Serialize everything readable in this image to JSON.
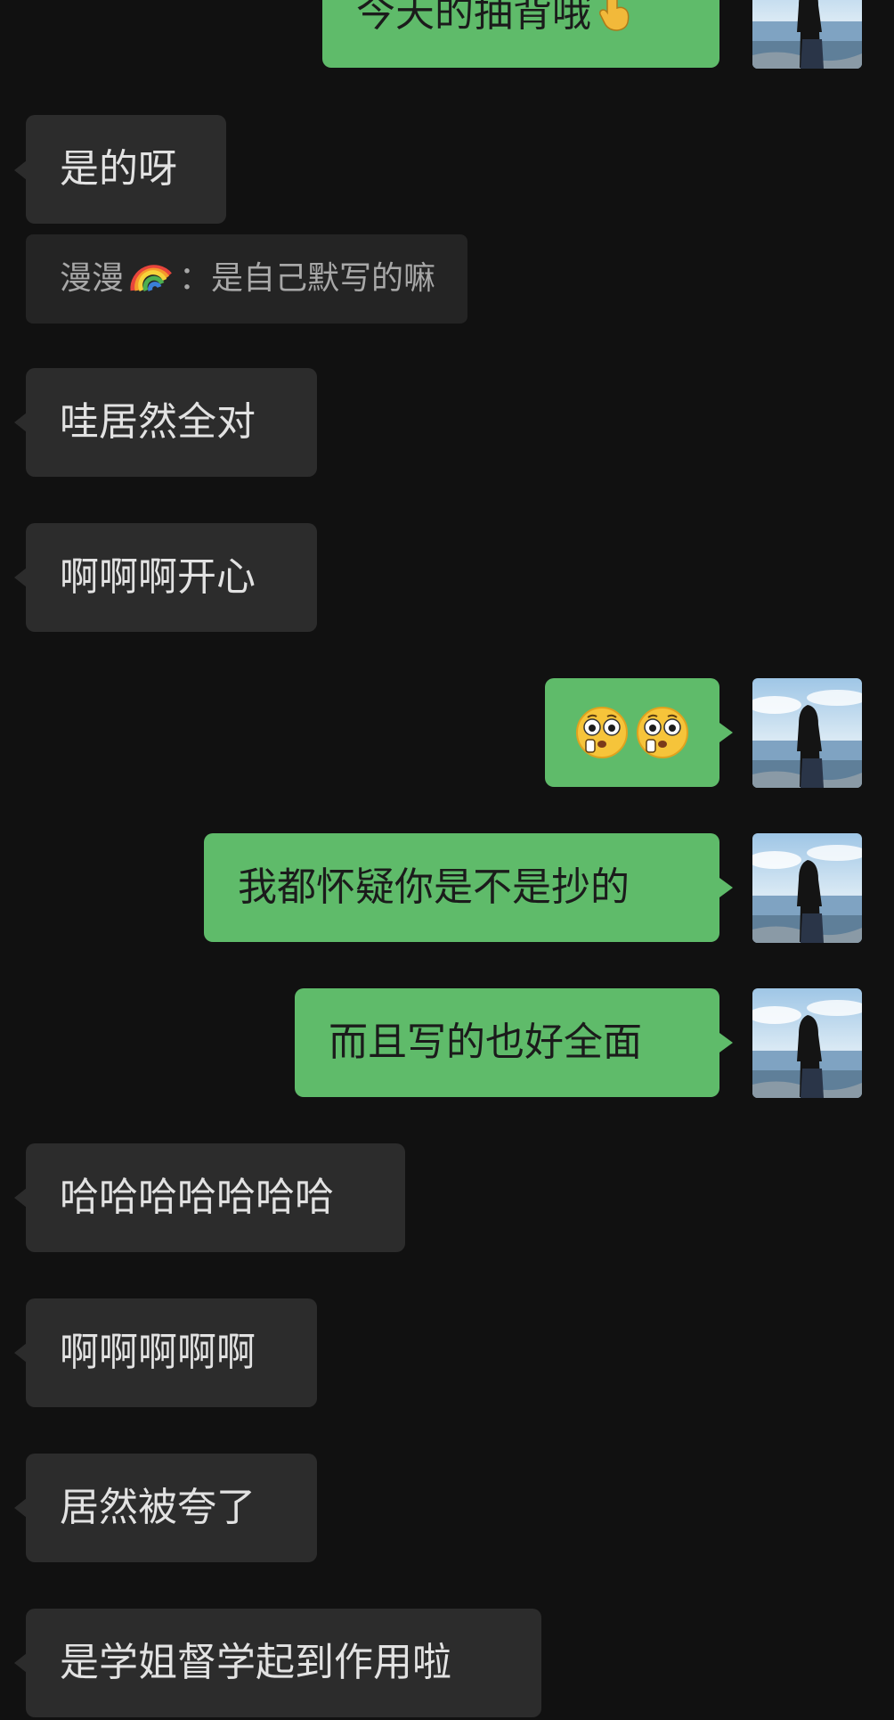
{
  "conversation": {
    "messages": [
      {
        "side": "out",
        "text": "今天的抽背哦",
        "trailing_icon": "pointing-finger-icon"
      },
      {
        "side": "in",
        "text": "是的呀"
      },
      {
        "side": "in",
        "text": "哇居然全对"
      },
      {
        "side": "in",
        "text": "啊啊啊开心"
      },
      {
        "side": "out",
        "emoji": [
          "flushed-face-icon",
          "flushed-face-icon"
        ]
      },
      {
        "side": "out",
        "text": "我都怀疑你是不是抄的"
      },
      {
        "side": "out",
        "text": "而且写的也好全面"
      },
      {
        "side": "in",
        "text": "哈哈哈哈哈哈哈"
      },
      {
        "side": "in",
        "text": "啊啊啊啊啊"
      },
      {
        "side": "in",
        "text": "居然被夸了"
      },
      {
        "side": "in",
        "text": "是学姐督学起到作用啦"
      }
    ],
    "quote": {
      "sender": "漫漫",
      "sender_icon": "rainbow-icon",
      "separator": "：",
      "text": "是自己默写的嘛"
    }
  },
  "colors": {
    "background": "#111111",
    "incoming_bubble": "#2c2c2c",
    "outgoing_bubble": "#5fbb6a",
    "incoming_text": "#e2e2e2",
    "outgoing_text": "#1b1b1b",
    "quote_bubble": "#242424",
    "quote_text": "#a8a8a8"
  }
}
